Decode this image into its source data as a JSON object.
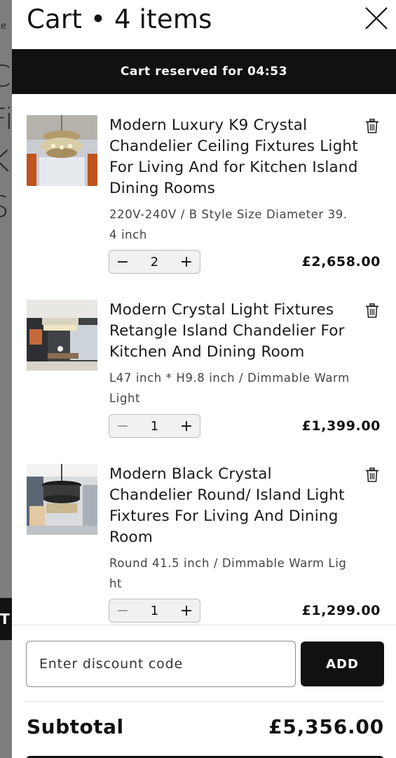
{
  "background_page": {
    "fragments": [
      "ce",
      "C",
      "Fi",
      "Ki",
      "S",
      "T"
    ]
  },
  "cart": {
    "title": "Cart • 4 items",
    "reserved_text": "Cart reserved for 04:53",
    "items": [
      {
        "title": "Modern Luxury K9 Crystal Chandelier Ceiling Fixtures Light For Living And for Kitchen Island Dining Rooms",
        "variant": "220V-240V / B Style Size Diameter 39.4 inch",
        "quantity": "2",
        "price": "£2,658.00"
      },
      {
        "title": "Modern Crystal Light Fixtures Retangle Island Chandelier For Kitchen And Dining Room",
        "variant": "L47 inch * H9.8 inch / Dimmable Warm Light",
        "quantity": "1",
        "price": "£1,399.00"
      },
      {
        "title": "Modern Black Crystal Chandelier Round/ Island Light Fixtures For Living And Dining Room",
        "variant": "Round 41.5 inch / Dimmable Warm Light",
        "quantity": "1",
        "price": "£1,299.00"
      }
    ],
    "qty_minus": "−",
    "qty_plus": "+"
  },
  "footer": {
    "discount_placeholder": "Enter discount code",
    "add_label": "ADD",
    "subtotal_label": "Subtotal",
    "subtotal_value": "£5,356.00"
  },
  "colors": {
    "banner": "#111111",
    "overlay": "#7d7d7d"
  },
  "icons": [
    "close-icon",
    "trash-icon"
  ]
}
